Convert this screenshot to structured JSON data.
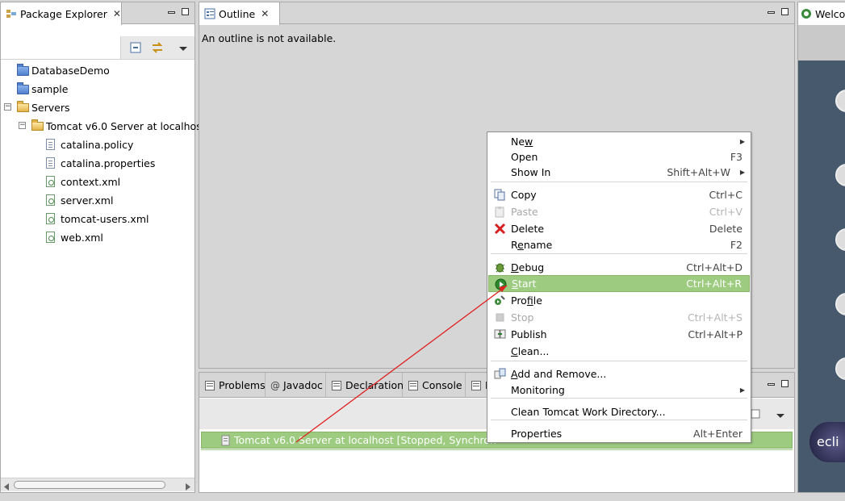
{
  "package_explorer": {
    "title": "Package Explorer",
    "tree": [
      {
        "label": "DatabaseDemo",
        "kind": "project",
        "level": 0
      },
      {
        "label": "sample",
        "kind": "project",
        "level": 0
      },
      {
        "label": "Servers",
        "kind": "open-folder",
        "level": 0
      },
      {
        "label": "Tomcat v6.0 Server at localhos",
        "kind": "open-folder",
        "level": 1
      },
      {
        "label": "catalina.policy",
        "kind": "file",
        "level": 2
      },
      {
        "label": "catalina.properties",
        "kind": "file",
        "level": 2
      },
      {
        "label": "context.xml",
        "kind": "xml",
        "level": 2
      },
      {
        "label": "server.xml",
        "kind": "xml",
        "level": 2
      },
      {
        "label": "tomcat-users.xml",
        "kind": "xml",
        "level": 2
      },
      {
        "label": "web.xml",
        "kind": "xml",
        "level": 2
      }
    ]
  },
  "outline": {
    "title": "Outline",
    "message": "An outline is not available."
  },
  "welcome": {
    "title": "Welco",
    "logo_text": "ecli"
  },
  "bottom_panel": {
    "tabs": [
      "Problems",
      "Javadoc",
      "Declaration",
      "Console",
      "L"
    ],
    "server_row": "Tomcat v6.0 Server at localhost  [Stopped, Synchron"
  },
  "context_menu": {
    "items": [
      {
        "label": "New",
        "shortcut": "",
        "submenu": true
      },
      {
        "label": "Open",
        "shortcut": "F3"
      },
      {
        "label": "Show In",
        "shortcut": "Shift+Alt+W",
        "submenu": true
      },
      {
        "label": "Copy",
        "shortcut": "Ctrl+C",
        "icon": "copy-icon"
      },
      {
        "label": "Paste",
        "shortcut": "Ctrl+V",
        "icon": "paste-icon",
        "disabled": true
      },
      {
        "label": "Delete",
        "shortcut": "Delete",
        "icon": "delete-icon"
      },
      {
        "label": "Rename",
        "shortcut": "F2"
      },
      {
        "label": "Debug",
        "shortcut": "Ctrl+Alt+D",
        "icon": "debug-icon"
      },
      {
        "label": "Start",
        "shortcut": "Ctrl+Alt+R",
        "icon": "start-icon",
        "highlighted": true
      },
      {
        "label": "Profile",
        "shortcut": "",
        "icon": "profile-icon"
      },
      {
        "label": "Stop",
        "shortcut": "Ctrl+Alt+S",
        "icon": "stop-icon",
        "disabled": true
      },
      {
        "label": "Publish",
        "shortcut": "Ctrl+Alt+P",
        "icon": "publish-icon"
      },
      {
        "label": "Clean...",
        "shortcut": ""
      },
      {
        "label": "Add and Remove...",
        "shortcut": "",
        "icon": "add-remove-icon"
      },
      {
        "label": "Monitoring",
        "shortcut": "",
        "submenu": true
      },
      {
        "label": "Clean Tomcat Work Directory...",
        "shortcut": ""
      },
      {
        "label": "Properties",
        "shortcut": "Alt+Enter"
      }
    ]
  },
  "colors": {
    "highlight": "#9dcb80",
    "annotation_arrow": "#e02020"
  }
}
